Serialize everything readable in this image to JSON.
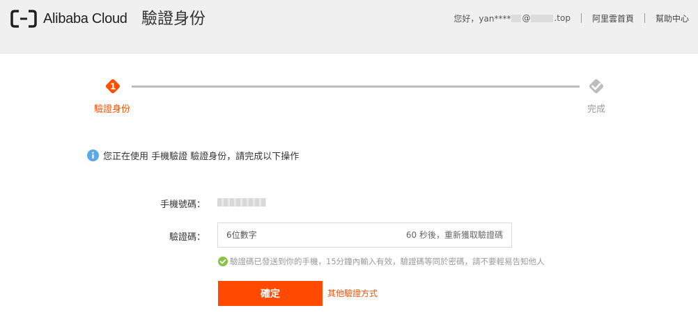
{
  "header": {
    "brand": "Alibaba Cloud",
    "page_title": "驗證身份",
    "greeting_prefix": "您好，yan****",
    "greeting_at": "@",
    "greeting_suffix": ".top",
    "nav": [
      {
        "label": "阿里雲首頁"
      },
      {
        "label": "幫助中心"
      }
    ]
  },
  "steps": [
    {
      "number": "1",
      "label": "驗證身份",
      "state": "active"
    },
    {
      "label": "完成",
      "state": "pending"
    }
  ],
  "notice": "您正在使用 手機驗證 驗證身份，請完成以下操作",
  "form": {
    "phone_label": "手機號碼：",
    "code_label": "驗證碼：",
    "code_value": "",
    "code_placeholder": "6位數字",
    "resend_text": "60 秒後，重新獲取驗證碼",
    "hint": "驗證碼已發送到你的手機，15分鐘內輸入有效，驗證碼等同於密碼，請不要輕易告知他人",
    "confirm_label": "確定",
    "other_method_label": "其他驗證方式"
  },
  "colors": {
    "accent": "#ff5000",
    "button": "#ff4a00",
    "info": "#5aa9e6",
    "success": "#8bc34a",
    "step_pending": "#bdbdbd"
  }
}
